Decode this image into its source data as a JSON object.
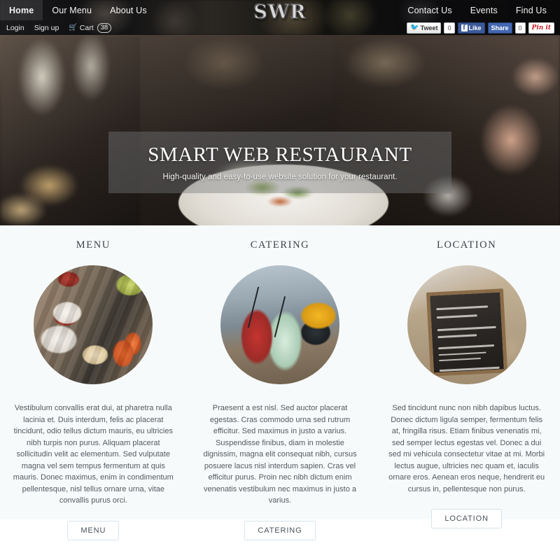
{
  "site": {
    "logo_text": "SWR",
    "brand_color": "#d8d8d8"
  },
  "header": {
    "nav_primary": [
      {
        "label": "Home",
        "active": true
      },
      {
        "label": "Our Menu",
        "active": false
      },
      {
        "label": "About Us",
        "active": false
      }
    ],
    "nav_secondary": [
      {
        "label": "Contact Us"
      },
      {
        "label": "Events"
      },
      {
        "label": "Find Us"
      }
    ],
    "account": {
      "login_label": "Login",
      "signup_label": "Sign up",
      "cart_label": "Cart",
      "cart_count": "38",
      "cart_icon": "cart-icon"
    }
  },
  "social": {
    "tweet_label": "Tweet",
    "tweet_count": "0",
    "like_label": "Like",
    "share_label": "Share",
    "share_count": "0",
    "pin_label": "Pin it",
    "twitter_color": "#1da1f2",
    "facebook_color": "#3b5998",
    "pinterest_color": "#c8232c"
  },
  "hero": {
    "title": "SMART WEB RESTAURANT",
    "subtitle": "High-quality and easy-to-use website solution for your restaurant.",
    "image_alt": "restaurant-table-plated-dish"
  },
  "features": {
    "columns": [
      {
        "title": "MENU",
        "image_alt": "brunch-sauces-toast-photo",
        "text": "Vestibulum convallis erat dui, at pharetra nulla lacinia et. Duis interdum, felis ac placerat tincidunt, odio tellus dictum mauris, eu ultricies nibh turpis non purus. Aliquam placerat sollicitudin velit ac elementum. Sed vulputate magna vel sem tempus fermentum at quis mauris. Donec maximus, enim in condimentum pellentesque, nisl tellus ornare urna, vitae convallis purus orci.",
        "button_label": "MENU"
      },
      {
        "title": "CATERING",
        "image_alt": "cocktails-drinks-photo",
        "text": "Praesent a est nisl. Sed auctor placerat egestas. Cras commodo urna sed rutrum efficitur. Sed maximus in justo a varius. Suspendisse finibus, diam in molestie dignissim, magna elit consequat nibh, cursus posuere lacus nisl interdum sapien. Cras vel efficitur purus. Proin nec nibh dictum enim venenatis vestibulum nec maximus in justo a varius.",
        "button_label": "CATERING"
      },
      {
        "title": "LOCATION",
        "image_alt": "chalkboard-todays-specials-photo",
        "text": "Sed tincidunt nunc non nibh dapibus luctus. Donec dictum ligula semper, fermentum felis at, fringilla risus. Etiam finibus venenatis mi, sed semper lectus egestas vel. Donec a dui sed mi vehicula consectetur vitae at mi. Morbi lectus augue, ultricies nec quam et, iaculis ornare eros. Aenean eros neque, hendrerit eu cursus in, pellentesque non purus.",
        "button_label": "LOCATION"
      }
    ],
    "background_color": "#f7fafb"
  }
}
